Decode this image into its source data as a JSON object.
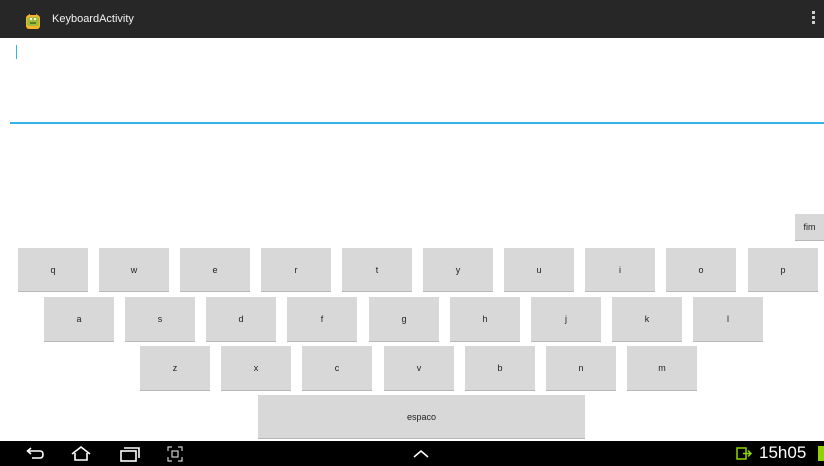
{
  "app": {
    "title": "KeyboardActivity",
    "icon": "android-icon",
    "menu_icon": "overflow-menu-icon"
  },
  "text_field": {
    "value": ""
  },
  "keyboard": {
    "done_label": "fim",
    "rows": [
      [
        "q",
        "w",
        "e",
        "r",
        "t",
        "y",
        "u",
        "i",
        "o",
        "p"
      ],
      [
        "a",
        "s",
        "d",
        "f",
        "g",
        "h",
        "j",
        "k",
        "l"
      ],
      [
        "z",
        "x",
        "c",
        "v",
        "b",
        "n",
        "m"
      ]
    ],
    "space_label": "espaco"
  },
  "navigation": {
    "back_icon": "back-icon",
    "home_icon": "home-icon",
    "recents_icon": "recents-icon",
    "screenshot_icon": "screenshot-icon",
    "up_icon": "chevron-up-icon"
  },
  "status": {
    "time": "15h05",
    "notification_icon": "usb-icon",
    "battery_icon": "battery-icon"
  },
  "colors": {
    "title_bar": "#272727",
    "accent": "#33b5e5",
    "key": "#d8d8d8",
    "battery": "#8fd400"
  }
}
